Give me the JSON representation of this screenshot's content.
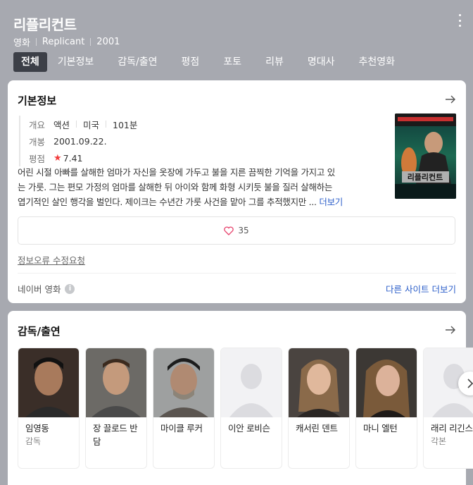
{
  "header": {
    "title": "리플리컨트",
    "meta": [
      "영화",
      "Replicant",
      "2001"
    ],
    "tabs": [
      "전체",
      "기본정보",
      "감독/출연",
      "평점",
      "포토",
      "리뷰",
      "명대사",
      "추천영화"
    ]
  },
  "basic_info": {
    "title": "기본정보",
    "overview_label": "개요",
    "genre": "액션",
    "country": "미국",
    "runtime": "101분",
    "release_label": "개봉",
    "release_date": "2001.09.22.",
    "rating_label": "평점",
    "rating": "7.41",
    "synopsis_line1": "어린 시절 아빠를 살해한 엄마가 자신을 옷장에 가두고 불을 지른 끔찍한 기억을 가지고 있",
    "synopsis_line2": "는 가룻. 그는 편모 가정의 엄마를 살해한 뒤 아이와 함께 화형 시키듯 불을 질러 살해하는",
    "synopsis_line3": "엽기적인 살인 행각을 벌인다. 제이크는 수년간 가룻 사건을 맡아 그를 추적했지만 ...",
    "more_label": "더보기",
    "like_count": "35",
    "report_label": "정보오류 수정요청",
    "source_label": "네이버 영화",
    "other_sites_label": "다른 사이트 더보기",
    "poster_text": "리플리컨트"
  },
  "cast": {
    "title": "감독/출연",
    "people": [
      {
        "name": "임영동",
        "role": "감독"
      },
      {
        "name": "장 끌로드 반담",
        "role": ""
      },
      {
        "name": "마이클 루커",
        "role": ""
      },
      {
        "name": "이안 로비슨",
        "role": ""
      },
      {
        "name": "캐서린 덴트",
        "role": ""
      },
      {
        "name": "마니 엘턴",
        "role": ""
      },
      {
        "name": "래리 리긴스",
        "role": "각본"
      }
    ]
  },
  "colors": {
    "accent_link": "#2b5ec9",
    "rating_star": "#f23c3c",
    "header_bg": "#a7a9b0"
  }
}
